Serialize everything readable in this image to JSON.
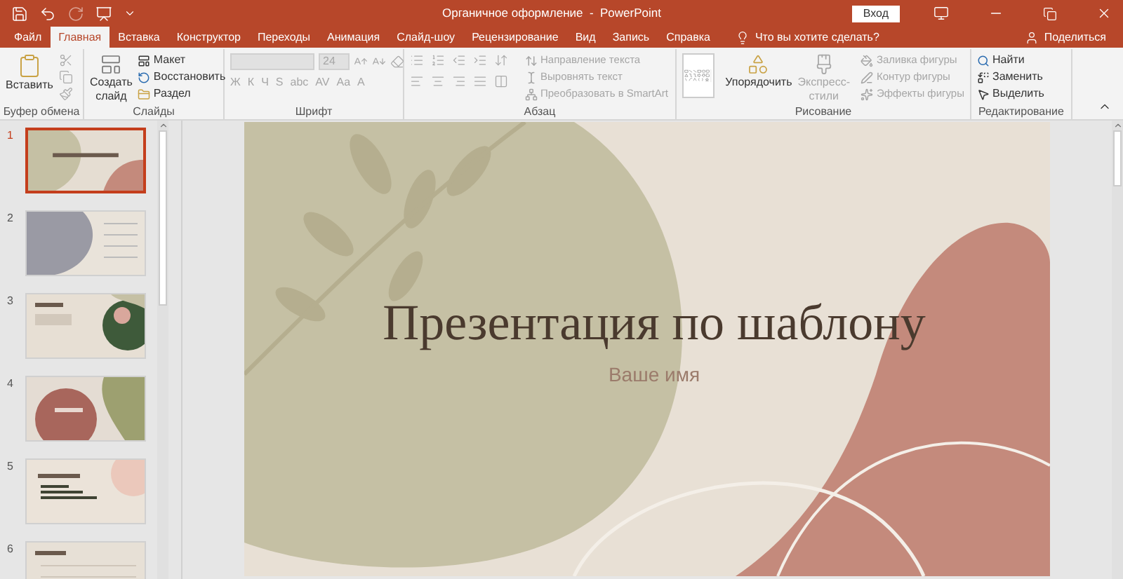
{
  "window": {
    "title": "Органичное оформление  -  PowerPoint",
    "sign_in": "Вход"
  },
  "tabs": [
    {
      "label": "Файл",
      "selected": false
    },
    {
      "label": "Главная",
      "selected": true
    },
    {
      "label": "Вставка",
      "selected": false
    },
    {
      "label": "Конструктор",
      "selected": false
    },
    {
      "label": "Переходы",
      "selected": false
    },
    {
      "label": "Анимация",
      "selected": false
    },
    {
      "label": "Слайд-шоу",
      "selected": false
    },
    {
      "label": "Рецензирование",
      "selected": false
    },
    {
      "label": "Вид",
      "selected": false
    },
    {
      "label": "Запись",
      "selected": false
    },
    {
      "label": "Справка",
      "selected": false
    }
  ],
  "tell_me": "Что вы хотите сделать?",
  "share": "Поделиться",
  "ribbon": {
    "clipboard": {
      "paste": "Вставить",
      "label": "Буфер обмена"
    },
    "slides": {
      "new_slide": [
        "Создать",
        "слайд"
      ],
      "items": [
        "Макет",
        "Восстановить",
        "Раздел"
      ],
      "label": "Слайды"
    },
    "font": {
      "size": "24",
      "styles": [
        "Ж",
        "К",
        "Ч",
        "S",
        "abc",
        "AV",
        "Aa",
        "A"
      ],
      "label": "Шрифт",
      "disabled": true
    },
    "paragraph": {
      "items": [
        {
          "label": "Направление текста",
          "disabled": true
        },
        {
          "label": "Выровнять текст",
          "disabled": true
        },
        {
          "label": "Преобразовать в SmartArt",
          "disabled": true
        }
      ],
      "label": "Абзац"
    },
    "drawing": {
      "arrange": "Упорядочить",
      "quick_styles": [
        "Экспресс-",
        "стили"
      ],
      "items": [
        {
          "label": "Заливка фигуры",
          "disabled": true
        },
        {
          "label": "Контур фигуры",
          "disabled": true
        },
        {
          "label": "Эффекты фигуры",
          "disabled": true
        }
      ],
      "label": "Рисование"
    },
    "editing": {
      "items": [
        "Найти",
        "Заменить",
        "Выделить"
      ],
      "label": "Редактирование"
    }
  },
  "thumbnails": [
    {
      "number": "1",
      "selected": true
    },
    {
      "number": "2",
      "selected": false
    },
    {
      "number": "3",
      "selected": false
    },
    {
      "number": "4",
      "selected": false
    },
    {
      "number": "5",
      "selected": false
    },
    {
      "number": "6",
      "selected": false
    }
  ],
  "slide": {
    "title": "Презентация по шаблону",
    "subtitle": "Ваше имя"
  }
}
